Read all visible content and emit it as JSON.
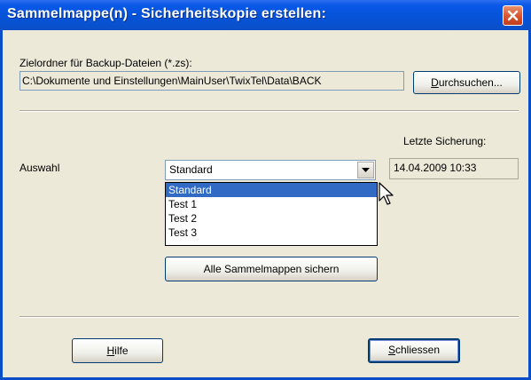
{
  "window": {
    "title": "Sammelmappe(n) - Sicherheitskopie erstellen:"
  },
  "target": {
    "label": "Zielordner für Backup-Dateien (*.zs):",
    "path": "C:\\Dokumente und Einstellungen\\MainUser\\TwixTel\\Data\\BACK",
    "browse_prefix": "D",
    "browse_rest": "urchsuchen..."
  },
  "selection": {
    "label": "Auswahl",
    "selected": "Standard",
    "options": [
      "Standard",
      "Test 1",
      "Test 2",
      "Test 3"
    ]
  },
  "last_backup": {
    "label": "Letzte Sicherung:",
    "value": "14.04.2009 10:33"
  },
  "actions": {
    "backup_all": "Alle Sammelmappen sichern",
    "help_prefix": "H",
    "help_rest": "ilfe",
    "close_prefix": "S",
    "close_rest": "chliessen"
  },
  "icons": {
    "close": "close-icon",
    "dropdown": "chevron-down-icon",
    "cursor": "mouse-pointer-icon"
  },
  "colors": {
    "titlebar": "#0a58e8",
    "selection": "#316ac5",
    "close_button": "#d6542f"
  }
}
